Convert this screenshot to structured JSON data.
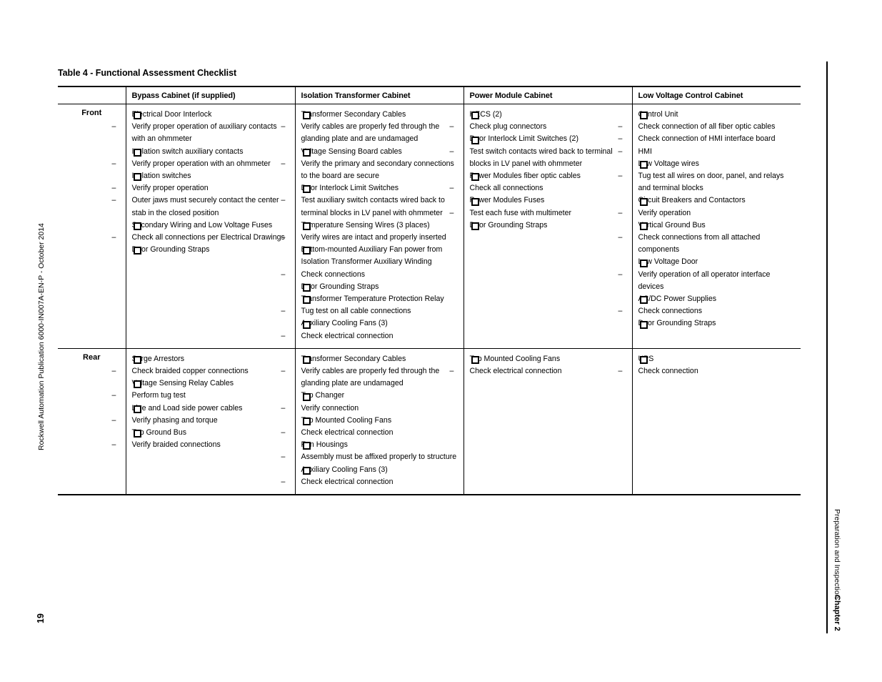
{
  "page": {
    "publication_line": "Rockwell Automation Publication 6000-IN007A-EN-P - October 2014",
    "page_number": "19",
    "chapter_title": "Preparation and Inspection",
    "chapter_number": "Chapter 2"
  },
  "table": {
    "caption": "Table 4 - Functional Assessment Checklist",
    "headers": {
      "rowlabel": "",
      "col1": "Bypass Cabinet (if supplied)",
      "col2": "Isolation Transformer Cabinet",
      "col3": "Power Module Cabinet",
      "col4": "Low Voltage Control Cabinet"
    },
    "rows": [
      {
        "label": "Front",
        "cells": {
          "bypass": [
            {
              "level": 1,
              "text": "Electrical Door Interlock"
            },
            {
              "level": 2,
              "text": "Verify proper operation of auxiliary contacts with an ohmmeter"
            },
            {
              "level": 1,
              "text": "Isolation switch auxiliary contacts"
            },
            {
              "level": 2,
              "text": "Verify proper operation with an ohmmeter"
            },
            {
              "level": 1,
              "text": "Isolation switches"
            },
            {
              "level": 2,
              "text": "Verify proper operation"
            },
            {
              "level": 2,
              "text": "Outer jaws must securely contact the center stab in the closed position"
            },
            {
              "level": 1,
              "text": "Secondary Wiring and Low Voltage Fuses"
            },
            {
              "level": 2,
              "text": "Check all connections per Electrical Drawings"
            },
            {
              "level": 1,
              "text": "Door Grounding Straps"
            }
          ],
          "isolation": [
            {
              "level": 1,
              "text": "Transformer Secondary Cables"
            },
            {
              "level": 2,
              "text": "Verify cables are properly fed through the glanding plate and are undamaged"
            },
            {
              "level": 1,
              "text": "Voltage Sensing Board cables"
            },
            {
              "level": 2,
              "text": "Verify the primary and secondary connections to the board are secure"
            },
            {
              "level": 1,
              "text": "Door Interlock Limit Switches"
            },
            {
              "level": 2,
              "text": "Test auxiliary switch contacts wired back to terminal blocks in LV panel with ohmmeter"
            },
            {
              "level": 1,
              "text": "Temperature Sensing Wires (3 places)"
            },
            {
              "level": 2,
              "text": "Verify wires are intact and properly inserted"
            },
            {
              "level": 1,
              "text": "Bottom-mounted Auxiliary Fan power from"
            },
            {
              "level": 0,
              "text": "Isolation Transformer Auxiliary Winding"
            },
            {
              "level": 2,
              "text": "Check connections"
            },
            {
              "level": 1,
              "text": "Door Grounding Straps"
            },
            {
              "level": 1,
              "text": "Transformer Temperature Protection Relay"
            },
            {
              "level": 2,
              "text": "Tug test on all cable connections"
            },
            {
              "level": 1,
              "text": "Auxiliary Cooling Fans (3)"
            },
            {
              "level": 2,
              "text": "Check electrical connection"
            }
          ],
          "power": [
            {
              "level": 1,
              "text": "HECS (2)"
            },
            {
              "level": 2,
              "text": "Check plug connectors"
            },
            {
              "level": 1,
              "text": "Door Interlock Limit Switches (2)"
            },
            {
              "level": 2,
              "text": "Test switch contacts wired back to terminal blocks in LV panel with ohmmeter"
            },
            {
              "level": 1,
              "text": "Power Modules fiber optic cables"
            },
            {
              "level": 2,
              "text": "Check all connections"
            },
            {
              "level": 1,
              "text": "Power Modules Fuses"
            },
            {
              "level": 2,
              "text": "Test each fuse with multimeter"
            },
            {
              "level": 1,
              "text": "Door Grounding Straps"
            }
          ],
          "lowvoltage": [
            {
              "level": 1,
              "text": "Control Unit"
            },
            {
              "level": 2,
              "text": "Check connection of all fiber optic cables"
            },
            {
              "level": 2,
              "text": "Check connection of HMI interface board"
            },
            {
              "level": 2,
              "text": "HMI"
            },
            {
              "level": 1,
              "text": "Low Voltage wires"
            },
            {
              "level": 2,
              "text": "Tug test all wires on door, panel, and relays and terminal blocks"
            },
            {
              "level": 1,
              "text": "Circuit Breakers and Contactors"
            },
            {
              "level": 2,
              "text": "Verify operation"
            },
            {
              "level": 1,
              "text": "Vertical Ground Bus"
            },
            {
              "level": 2,
              "text": "Check connections from all attached components"
            },
            {
              "level": 1,
              "text": "Low Voltage Door"
            },
            {
              "level": 2,
              "text": "Verify operation of all operator interface devices"
            },
            {
              "level": 1,
              "text": "AC/DC Power Supplies"
            },
            {
              "level": 2,
              "text": "Check connections"
            },
            {
              "level": 1,
              "text": "Door Grounding Straps"
            }
          ]
        }
      },
      {
        "label": "Rear",
        "cells": {
          "bypass": [
            {
              "level": 1,
              "text": "Surge Arrestors"
            },
            {
              "level": 2,
              "text": "Check braided copper connections"
            },
            {
              "level": 1,
              "text": "Voltage Sensing Relay Cables"
            },
            {
              "level": 2,
              "text": "Perform tug test"
            },
            {
              "level": 1,
              "text": "Line and Load side power cables"
            },
            {
              "level": 2,
              "text": "Verify phasing and torque"
            },
            {
              "level": 1,
              "text": "Top Ground Bus"
            },
            {
              "level": 2,
              "text": "Verify braided connections"
            }
          ],
          "isolation": [
            {
              "level": 1,
              "text": "Transformer Secondary Cables"
            },
            {
              "level": 2,
              "text": "Verify cables are properly fed through the glanding plate are undamaged"
            },
            {
              "level": 1,
              "text": "Tap Changer"
            },
            {
              "level": 2,
              "text": "Verify connection"
            },
            {
              "level": 1,
              "text": "Top Mounted Cooling Fans"
            },
            {
              "level": 2,
              "text": "Check electrical connection"
            },
            {
              "level": 1,
              "text": "Fan Housings"
            },
            {
              "level": 2,
              "text": "Assembly must be affixed properly to structure"
            },
            {
              "level": 1,
              "text": "Auxiliary Cooling Fans (3)"
            },
            {
              "level": 2,
              "text": "Check electrical connection"
            }
          ],
          "power": [
            {
              "level": 1,
              "text": "Top Mounted Cooling Fans"
            },
            {
              "level": 2,
              "text": "Check electrical connection"
            }
          ],
          "lowvoltage": [
            {
              "level": 1,
              "text": "UPS"
            },
            {
              "level": 2,
              "text": "Check connection"
            }
          ]
        }
      }
    ]
  }
}
